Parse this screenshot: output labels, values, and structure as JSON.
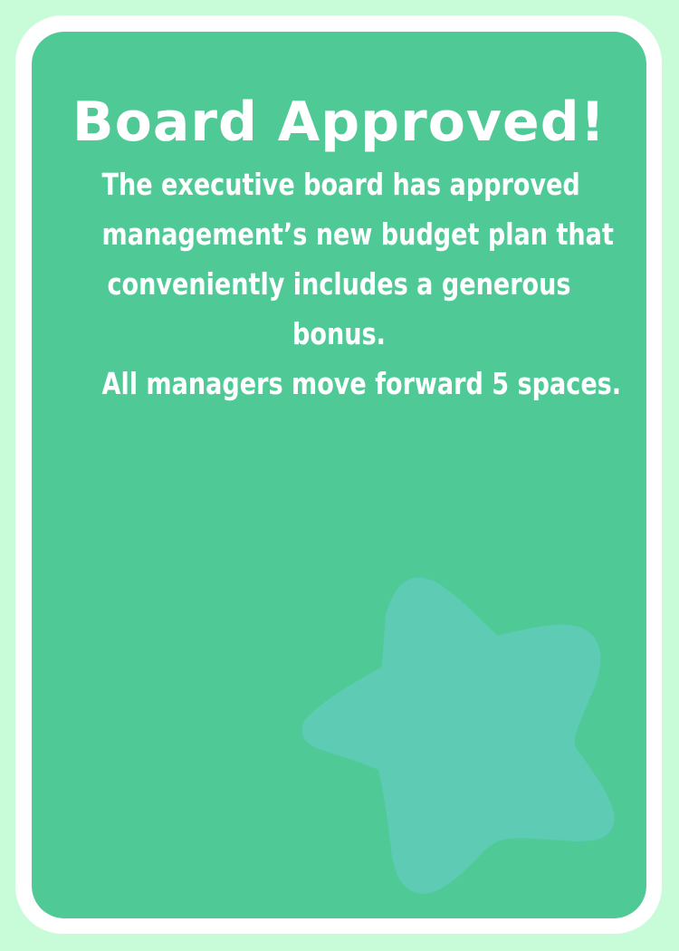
{
  "card": {
    "title": "Board Approved!",
    "body_lines": [
      "The executive board has approved",
      "management’s new budget plan that",
      "conveniently includes a generous",
      "bonus.",
      "All managers move forward 5 spaces."
    ]
  },
  "icons": {
    "decoration": "star-icon"
  },
  "colors": {
    "page_background": "#c8fbd8",
    "card_border": "#ffffff",
    "card_fill": "#4fca97",
    "star_fill": "#5ecbb5",
    "text": "#ffffff"
  }
}
